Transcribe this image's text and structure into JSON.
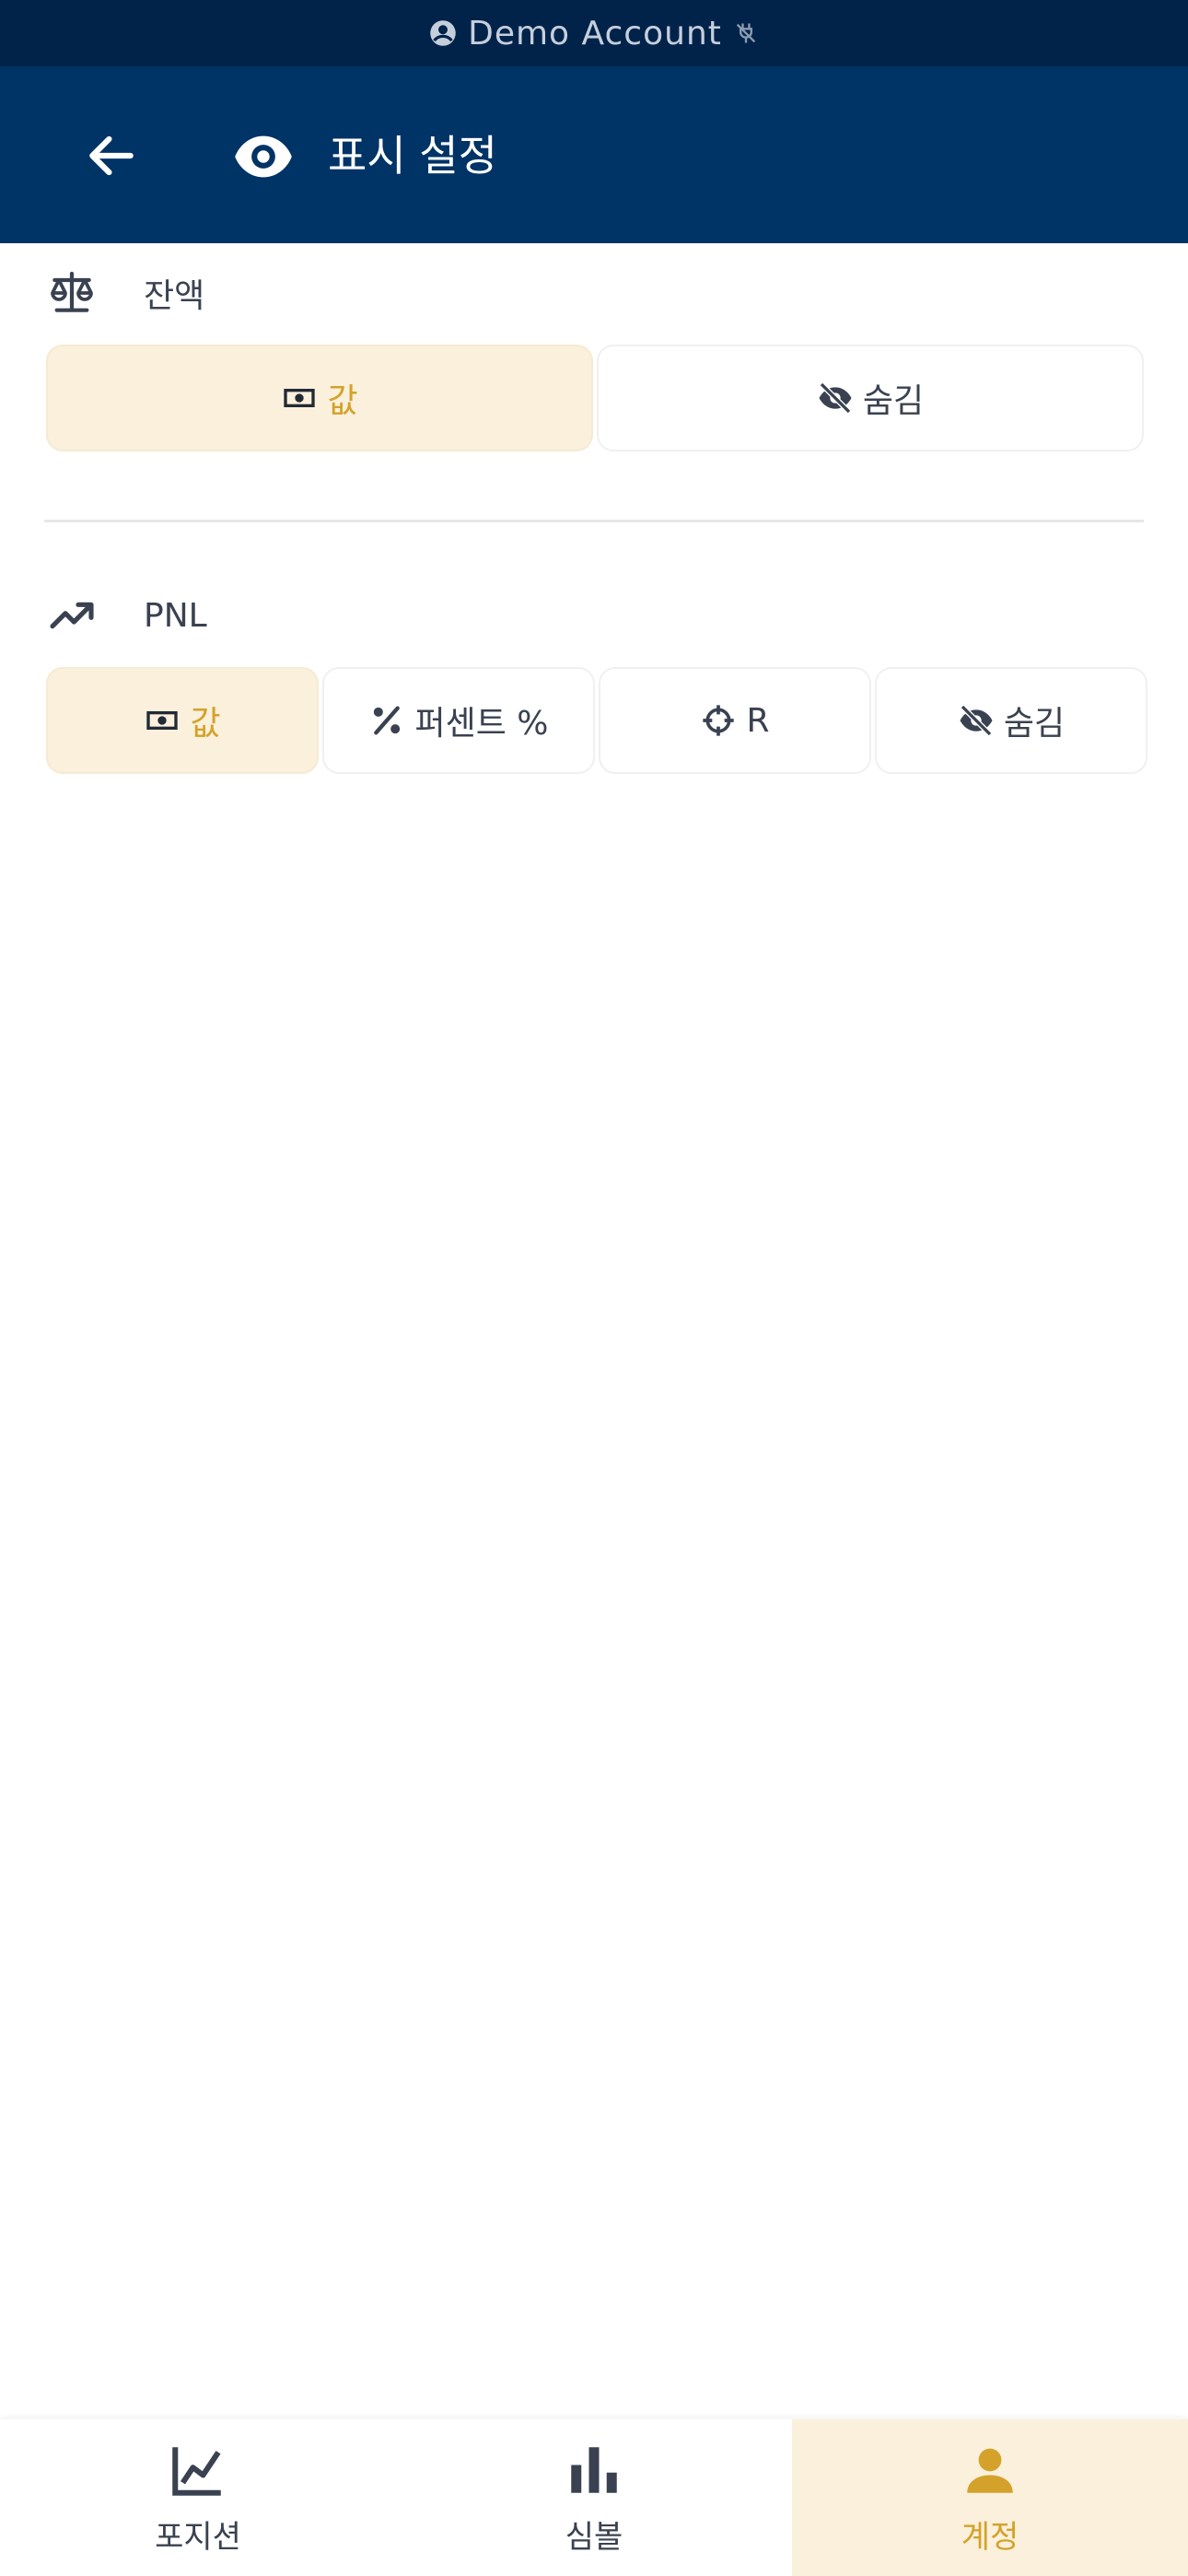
{
  "demo_bar": {
    "label": "Demo Account"
  },
  "header": {
    "title": "표시 설정"
  },
  "balance": {
    "label": "잔액",
    "options": [
      {
        "label": "값",
        "selected": true
      },
      {
        "label": "숨김",
        "selected": false
      }
    ]
  },
  "pnl": {
    "label": "PNL",
    "options": [
      {
        "label": "값",
        "selected": true
      },
      {
        "label": "퍼센트 %",
        "selected": false
      },
      {
        "label": "R",
        "selected": false
      },
      {
        "label": "숨김",
        "selected": false
      }
    ]
  },
  "bottom_nav": {
    "items": [
      {
        "label": "포지션",
        "icon": "line-chart-icon",
        "active": false
      },
      {
        "label": "심볼",
        "icon": "bar-chart-icon",
        "active": false
      },
      {
        "label": "계정",
        "icon": "person-icon",
        "active": true
      }
    ]
  },
  "colors": {
    "header_bg": "#003366",
    "top_bar_bg": "#01234a",
    "accent": "#d4a22a",
    "accent_bg": "#faf0dc"
  }
}
